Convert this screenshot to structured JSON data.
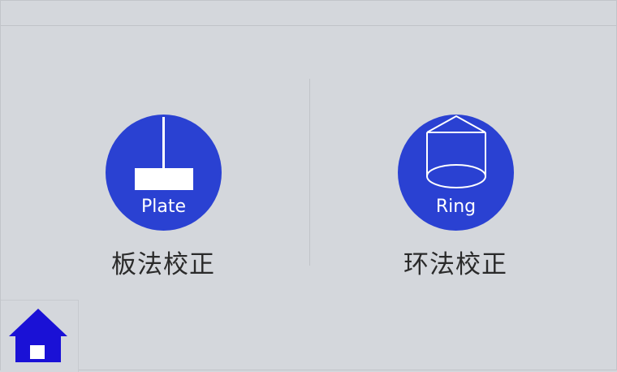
{
  "options": {
    "plate": {
      "icon_label": "Plate",
      "caption": "板法校正",
      "icon": "plate-icon"
    },
    "ring": {
      "icon_label": "Ring",
      "caption": "环法校正",
      "icon": "ring-icon"
    }
  },
  "home": {
    "icon": "home-icon"
  },
  "colors": {
    "background": "#d4d7dc",
    "accent": "#2a41d2",
    "home_icon": "#1a11d6",
    "text": "#2a2a2a"
  }
}
